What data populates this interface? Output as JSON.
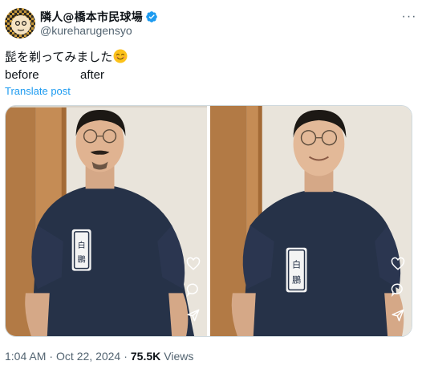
{
  "author": {
    "display_name": "隣人@橋本市民球場",
    "handle": "@kureharugensyo",
    "verified": true
  },
  "header": {
    "more_label": "···"
  },
  "tweet": {
    "line1": "髭を剃ってみました",
    "emoji": "smiling-face-with-smiling-eyes",
    "line2_left": "before",
    "line2_right": "after",
    "translate_label": "Translate post"
  },
  "media": [
    {
      "label": "before"
    },
    {
      "label": "after"
    }
  ],
  "meta": {
    "time": "1:04 AM",
    "separator": "·",
    "date": "Oct 22, 2024",
    "views_count": "75.5K",
    "views_label": "Views"
  },
  "colors": {
    "accent": "#1d9bf0",
    "muted": "#536471",
    "text": "#0f1419"
  }
}
